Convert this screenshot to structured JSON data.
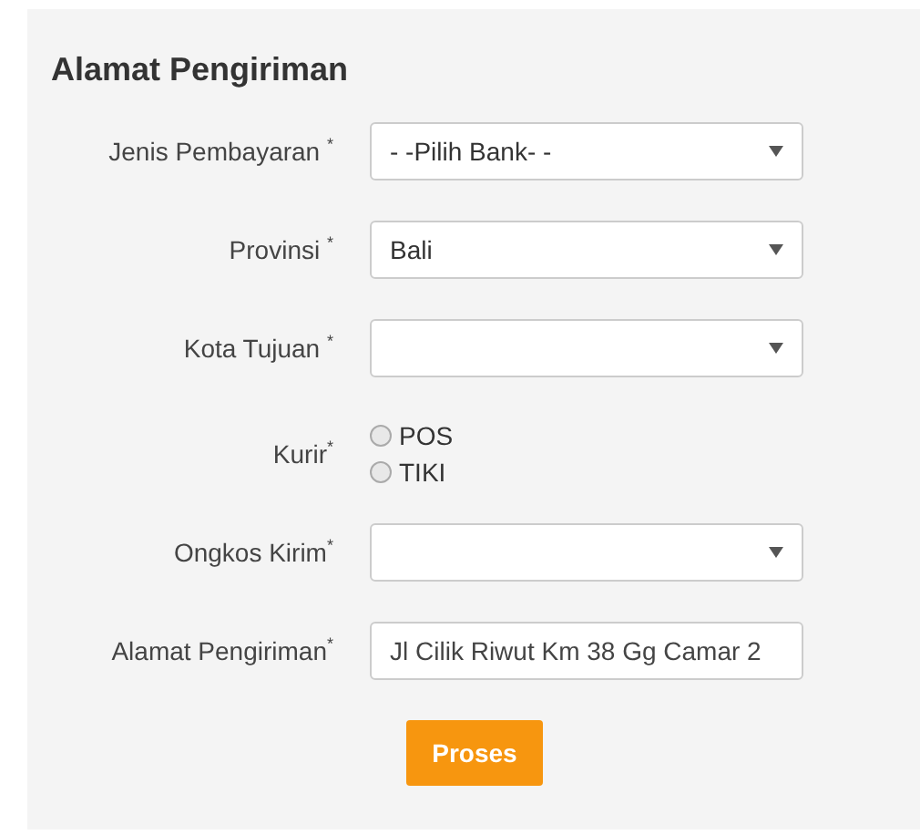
{
  "title": "Alamat Pengiriman",
  "fields": [
    {
      "kind": "select",
      "label": "Jenis Pembayaran $^{*}$",
      "value": "- -Pilih Bank- -"
    },
    {
      "kind": "select",
      "label": "Provinsi $^{*}$",
      "value": "Bali"
    },
    {
      "kind": "select",
      "label": "Kota Tujuan $^{*}$"
    },
    {
      "kind": "radio",
      "label": "Kurir$^{*}$",
      "options": [
        {
          "label": "POS",
          "selected": false
        },
        {
          "label": "TIKI",
          "selected": false
        }
      ]
    },
    {
      "kind": "select",
      "label": "Ongkos Kirim$^{*}$"
    },
    {
      "kind": "text",
      "label": "Alamat Pengiriman$^{*}$",
      "value": "Jl Cilik Riwut Km 38 Gg Camar 2"
    }
  ],
  "submit": "Proses"
}
